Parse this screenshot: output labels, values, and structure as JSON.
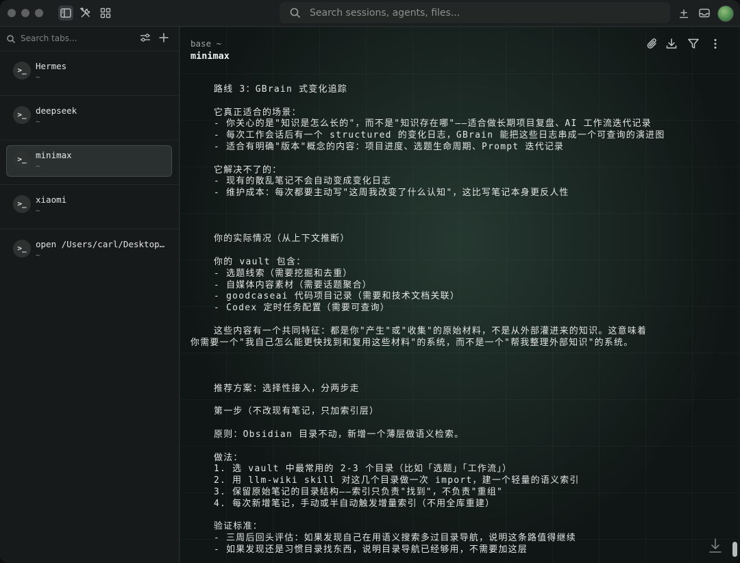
{
  "titlebar": {
    "search_placeholder": "Search sessions, agents, files..."
  },
  "sidebar": {
    "tab_search_placeholder": "Search tabs...",
    "sessions": [
      {
        "name": "Hermes",
        "sub": "~",
        "active": false
      },
      {
        "name": "deepseek",
        "sub": "~",
        "active": false
      },
      {
        "name": "minimax",
        "sub": "~",
        "active": true
      },
      {
        "name": "xiaomi",
        "sub": "~",
        "active": false
      },
      {
        "name": "open /Users/carl/Desktop/...",
        "sub": "~",
        "active": false
      }
    ]
  },
  "main": {
    "path": "base ~",
    "title": "minimax",
    "lines": [
      "路线 3：GBrain 式变化追踪",
      "",
      "它真正适合的场景：",
      "- 你关心的是\"知识是怎么长的\"，而不是\"知识存在哪\"——适合做长期项目复盘、AI 工作流迭代记录",
      "- 每次工作会话后有一个 structured 的变化日志，GBrain 能把这些日志串成一个可查询的演进图",
      "- 适合有明确\"版本\"概念的内容：项目进度、选题生命周期、Prompt 迭代记录",
      "",
      "它解决不了的：",
      "- 现有的散乱笔记不会自动变成变化日志",
      "- 维护成本：每次都要主动写\"这周我改变了什么认知\"，这比写笔记本身更反人性",
      "",
      "",
      "",
      "你的实际情况（从上下文推断）",
      "",
      "你的 vault 包含：",
      "- 选题线索（需要挖掘和去重）",
      "- 自媒体内容素材（需要话题聚合）",
      "- goodcaseai 代码项目记录（需要和技术文档关联）",
      "- Codex 定时任务配置（需要可查询）",
      "",
      "这些内容有一个共同特征：都是你\"产生\"或\"收集\"的原始材料，不是从外部灌进来的知识。这意味着",
      "@你需要一个\"我自己怎么能更快找到和复用这些材料\"的系统，而不是一个\"帮我整理外部知识\"的系统。",
      "",
      "",
      "",
      "推荐方案：选择性接入，分两步走",
      "",
      "第一步（不改现有笔记，只加索引层）",
      "",
      "原则：Obsidian 目录不动，新增一个薄层做语义检索。",
      "",
      "做法：",
      "1. 选 vault 中最常用的 2-3 个目录（比如「选题」「工作流」）",
      "2. 用 llm-wiki skill 对这几个目录做一次 import，建一个轻量的语义索引",
      "3. 保留原始笔记的目录结构——索引只负责\"找到\"，不负责\"重组\"",
      "4. 每次新增笔记，手动或半自动触发增量索引（不用全库重建）",
      "",
      "验证标准：",
      "- 三周后回头评估：如果发现自己在用语义搜索多过目录导航，说明这条路值得继续",
      "- 如果发现还是习惯目录找东西，说明目录导航已经够用，不需要加这层"
    ]
  }
}
